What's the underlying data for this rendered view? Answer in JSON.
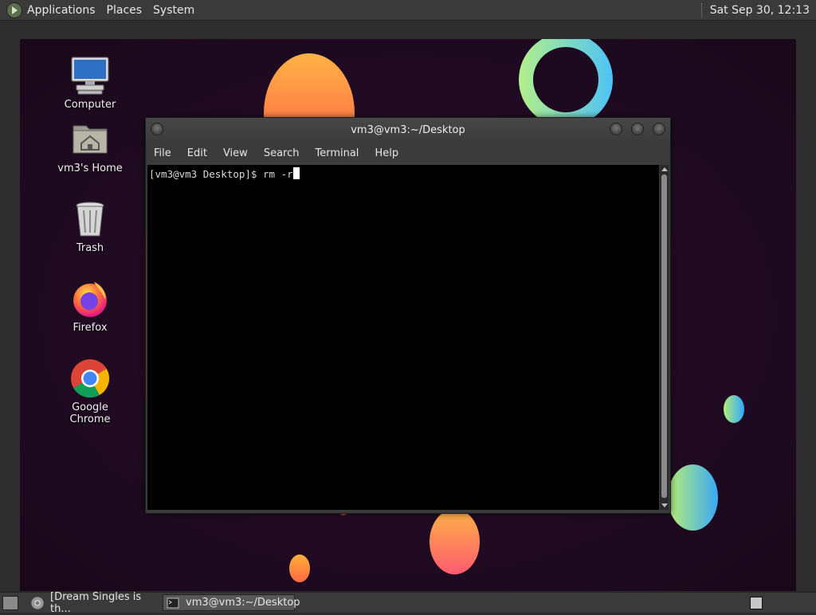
{
  "top_panel": {
    "menus": [
      "Applications",
      "Places",
      "System"
    ],
    "clock": "Sat Sep 30, 12:13"
  },
  "desktop": {
    "icons": [
      {
        "label": "Computer",
        "icon": "computer-icon"
      },
      {
        "label": "vm3's Home",
        "icon": "home-folder-icon"
      },
      {
        "label": "Trash",
        "icon": "trash-icon"
      },
      {
        "label": "Firefox",
        "icon": "firefox-icon"
      },
      {
        "label": "Google Chrome",
        "icon": "chrome-icon"
      }
    ]
  },
  "terminal": {
    "title": "vm3@vm3:~/Desktop",
    "menu": [
      "File",
      "Edit",
      "View",
      "Search",
      "Terminal",
      "Help"
    ],
    "prompt": "[vm3@vm3 Desktop]$ ",
    "command": "rm -r"
  },
  "taskbar": {
    "tasks": [
      {
        "label": "[Dream Singles is th...",
        "icon": "chrome-icon"
      },
      {
        "label": "vm3@vm3:~/Desktop",
        "icon": "terminal-icon"
      }
    ]
  }
}
